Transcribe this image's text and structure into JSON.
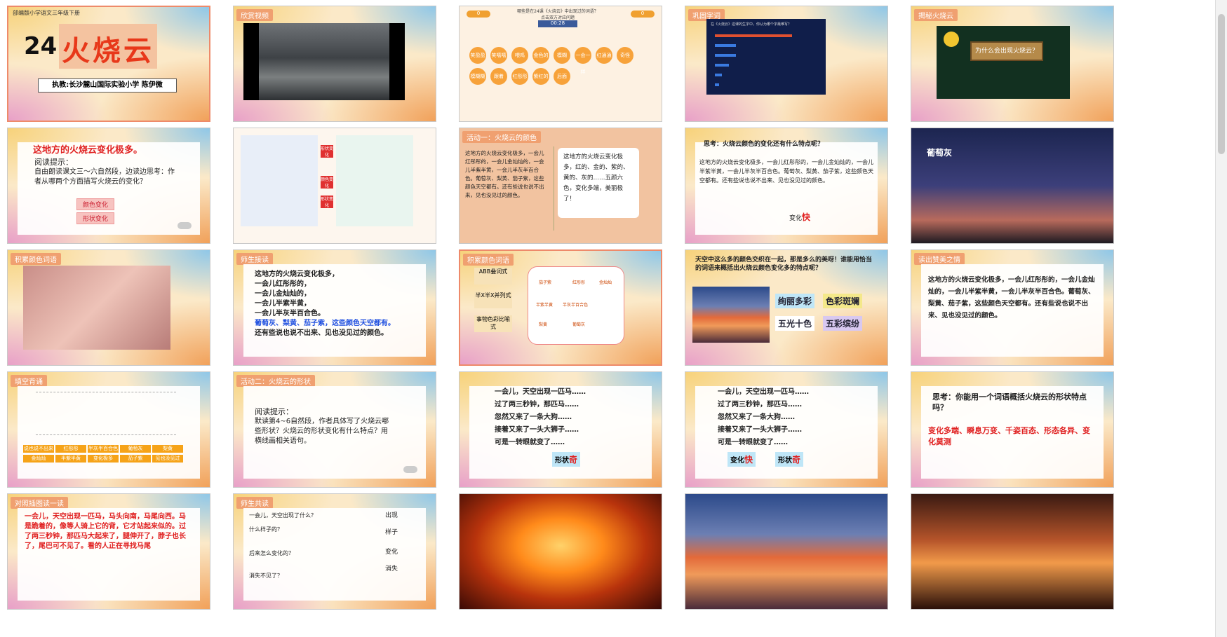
{
  "slides": [
    {
      "n": "1",
      "title": "火烧云",
      "num_label": "24",
      "top": "部编版小学语文三年级下册",
      "author": "执教:长沙麓山国际实验小学  陈伊微"
    },
    {
      "n": "2",
      "tag": "欣赏视频"
    },
    {
      "n": "3",
      "score_left": "0",
      "score_right": "0",
      "question": "哪些是在24课《火烧云》中出现过的词语？ 点击双方对应问题",
      "timer": "00:28",
      "words": [
        "笑盈盈",
        "笑嘻嘻",
        "喂鸡",
        "金色的",
        "模糊",
        "一会一样",
        "红通通",
        "奇怪",
        "模糊糊",
        "跟着",
        "红彤彤",
        "紫红的",
        "后面"
      ]
    },
    {
      "n": "4",
      "tag": "巩固字词",
      "question": "在《火烧云》这课的生字中，你认为哪个字最难写？"
    },
    {
      "n": "5",
      "tag": "揭秘火烧云",
      "sign": "为什么会出现火烧云？"
    },
    {
      "n": "6",
      "heading": "这地方的火烧云变化极多。",
      "tip_label": "阅读提示：",
      "tip": "自由朗读课文三～六自然段，边读边思考：作者从哪两个方面描写火烧云的变化？",
      "btn1": "颜色变化",
      "btn2": "形状变化"
    },
    {
      "n": "7",
      "l1": "形状变化",
      "l2": "颜色变化",
      "l3": "形状变化"
    },
    {
      "n": "8",
      "tag": "活动一：火烧云的颜色",
      "left": "这地方的火烧云变化极多，一会儿红彤彤的，一会儿金灿灿的，一会儿半紫半黄，一会儿半灰半百合色。葡萄灰、梨黄、茄子紫，这些颜色天空都有。还有些说也说不出来，见也没见过的颜色。",
      "right": "这地方的火烧云变化极多，红的、金的、紫的、黄的、灰的……五颜六色，变化多端，美丽极了！"
    },
    {
      "n": "9",
      "q": "思考：火烧云颜色的变化还有什么特点呢？",
      "text": "这地方的火烧云变化极多，一会儿红彤彤的，一会儿金灿灿的，一会儿半紫半黄，一会儿半灰半百合色。葡萄灰、梨黄、茄子紫，这些颜色天空都有。还有些说也说不出来、见也没见过的颜色。",
      "label": "变化",
      "accent": "快"
    },
    {
      "n": "10",
      "caption": "葡萄灰"
    },
    {
      "n": "11",
      "tag": "积累颜色词语"
    },
    {
      "n": "12",
      "tag": "师生接读",
      "lines": [
        "这地方的火烧云变化极多，",
        "一会儿红彤彤的，",
        "一会儿金灿灿的，",
        "一会儿半紫半黄，",
        "一会儿半灰半百合色。",
        "葡萄灰、梨黄、茄子紫，这些颜色天空都有。",
        "还有些说也说不出来、见也没见过的颜色。"
      ]
    },
    {
      "n": "13",
      "tag": "积累颜色词语",
      "c1": "ABB叠词式",
      "c2": "半X半X并列式",
      "c3": "事物色彩比喻式",
      "w": [
        "茄子紫",
        "红彤彤",
        "金灿灿",
        "半紫半黄",
        "半灰半百合色",
        "梨黄",
        "葡萄灰"
      ]
    },
    {
      "n": "14",
      "q": "天空中这么多的颜色交织在一起，那是多么的美呀！谁能用恰当的词语来概括出火烧云颜色变化多的特点呢？",
      "b1": "绚丽多彩",
      "b2": "色彩斑斓",
      "b3": "五光十色",
      "b4": "五彩缤纷"
    },
    {
      "n": "15",
      "tag": "读出赞美之情",
      "text": "这地方的火烧云变化极多，一会儿红彤彤的，一会儿金灿灿的，一会儿半紫半黄，一会儿半灰半百合色。葡萄灰、梨黄、茄子紫，这些颜色天空都有。还有些说也说不出来、见也没见过的颜色。"
    },
    {
      "n": "16",
      "tag": "填空背诵",
      "chips": [
        "说也说不出来",
        "红彤彤",
        "半灰半百合色",
        "葡萄灰",
        "梨黄",
        "金灿灿",
        "半紫半黄",
        "变化极多",
        "茄子紫",
        "见也没见过"
      ]
    },
    {
      "n": "17",
      "tag": "活动二：火烧云的形状",
      "tip_label": "阅读提示：",
      "tip": "默读第4~6自然段，作者具体写了火烧云哪些形状？火烧云的形状变化有什么特点？用横线画相关语句。"
    },
    {
      "n": "18",
      "lines": [
        "一会儿，天空出现一匹马……",
        "过了两三秒钟，那匹马……",
        "忽然又来了一条大狗……",
        "接着又来了一头大狮子……",
        "可是一转眼就变了……"
      ],
      "label": "形状",
      "accent": "奇"
    },
    {
      "n": "19",
      "lines": [
        "一会儿，天空出现一匹马……",
        "过了两三秒钟，那匹马……",
        "忽然又来了一条大狗……",
        "接着又来了一头大狮子……",
        "可是一转眼就变了……"
      ],
      "label1": "变化",
      "accent1": "快",
      "label2": "形状",
      "accent2": "奇"
    },
    {
      "n": "20",
      "q": "思考：你能用一个词语概括火烧云的形状特点吗？",
      "a": "变化多端、瞬息万变、千姿百态、形态各异、变化莫测"
    },
    {
      "n": "",
      "tag": "对照插图读一读",
      "text": "一会儿，天空出现一匹马，马头向南，马尾向西。马是跪着的，像等人骑上它的背，它才站起来似的。过了两三秒钟，那匹马大起来了，腿伸开了，脖子也长了，尾巴可不见了。看的人正在寻找马尾"
    },
    {
      "n": "",
      "tag": "师生共读",
      "q1": "一会儿，天空出现了什么？",
      "q2": "什么样子的？",
      "q3": "后来怎么变化的？",
      "q4": "消失不见了？",
      "f1": "出现",
      "f2": "样子",
      "f3": "变化",
      "f4": "消失"
    },
    {
      "n": ""
    },
    {
      "n": ""
    },
    {
      "n": ""
    }
  ],
  "logo": "麓山国际学校之音"
}
